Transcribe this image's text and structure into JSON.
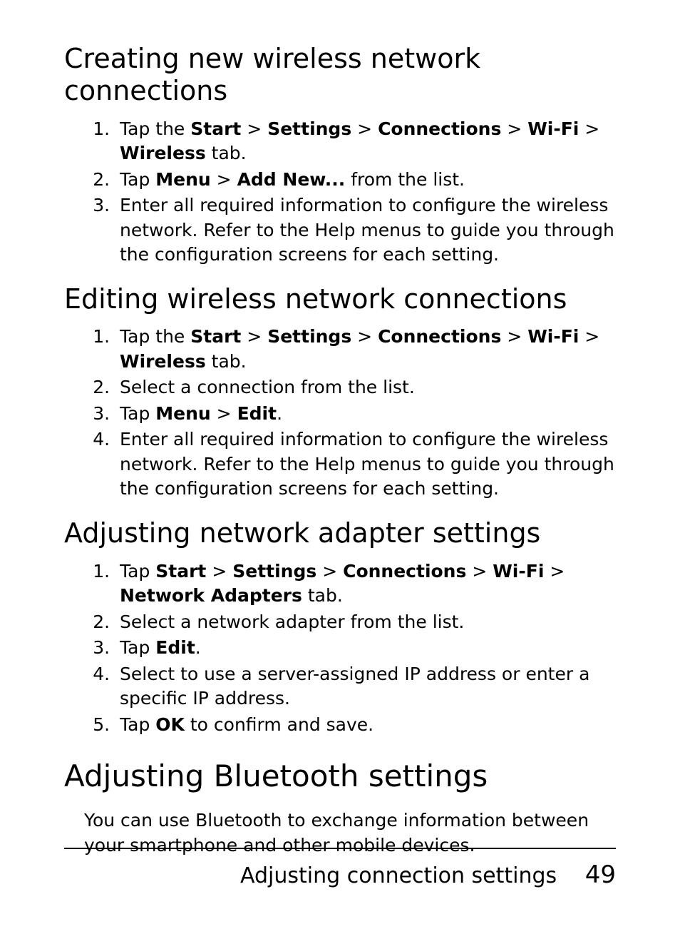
{
  "sections": [
    {
      "heading": "Creating new wireless network connections",
      "level": "h2",
      "items": [
        {
          "segments": [
            {
              "t": "Tap the "
            },
            {
              "t": "Start",
              "b": true
            },
            {
              "t": " > "
            },
            {
              "t": "Settings",
              "b": true
            },
            {
              "t": " > "
            },
            {
              "t": "Connections",
              "b": true
            },
            {
              "t": " > "
            },
            {
              "t": "Wi-Fi",
              "b": true
            },
            {
              "t": " > "
            },
            {
              "t": "Wireless",
              "b": true
            },
            {
              "t": " tab."
            }
          ]
        },
        {
          "segments": [
            {
              "t": "Tap "
            },
            {
              "t": "Menu",
              "b": true
            },
            {
              "t": " > "
            },
            {
              "t": "Add New...",
              "b": true
            },
            {
              "t": " from the list."
            }
          ]
        },
        {
          "segments": [
            {
              "t": "Enter all required information to configure the wireless network. Refer to the Help menus to guide you through the configuration screens for each setting."
            }
          ]
        }
      ]
    },
    {
      "heading": "Editing wireless network connections",
      "level": "h2",
      "items": [
        {
          "segments": [
            {
              "t": "Tap the "
            },
            {
              "t": "Start",
              "b": true
            },
            {
              "t": " > "
            },
            {
              "t": "Settings",
              "b": true
            },
            {
              "t": " > "
            },
            {
              "t": "Connections",
              "b": true
            },
            {
              "t": " > "
            },
            {
              "t": "Wi-Fi",
              "b": true
            },
            {
              "t": " > "
            },
            {
              "t": "Wireless",
              "b": true
            },
            {
              "t": " tab."
            }
          ]
        },
        {
          "segments": [
            {
              "t": "Select a connection from the list."
            }
          ]
        },
        {
          "segments": [
            {
              "t": "Tap "
            },
            {
              "t": "Menu",
              "b": true
            },
            {
              "t": " > "
            },
            {
              "t": "Edit",
              "b": true
            },
            {
              "t": "."
            }
          ]
        },
        {
          "segments": [
            {
              "t": "Enter all required information to configure the wireless network. Refer to the Help menus to guide you through the configuration screens for each setting."
            }
          ]
        }
      ]
    },
    {
      "heading": "Adjusting network adapter settings",
      "level": "h2",
      "items": [
        {
          "segments": [
            {
              "t": "Tap "
            },
            {
              "t": "Start",
              "b": true
            },
            {
              "t": " > "
            },
            {
              "t": "Settings",
              "b": true
            },
            {
              "t": " > "
            },
            {
              "t": "Connections",
              "b": true
            },
            {
              "t": " > "
            },
            {
              "t": "Wi-Fi",
              "b": true
            },
            {
              "t": " > "
            },
            {
              "t": "Network Adapters",
              "b": true
            },
            {
              "t": " tab."
            }
          ]
        },
        {
          "segments": [
            {
              "t": "Select a network adapter from the list."
            }
          ]
        },
        {
          "segments": [
            {
              "t": "Tap "
            },
            {
              "t": "Edit",
              "b": true
            },
            {
              "t": "."
            }
          ]
        },
        {
          "segments": [
            {
              "t": "Select to use a server-assigned IP address or enter a specific IP address."
            }
          ]
        },
        {
          "segments": [
            {
              "t": "Tap "
            },
            {
              "t": "OK",
              "b": true
            },
            {
              "t": " to confirm and save."
            }
          ]
        }
      ]
    },
    {
      "heading": "Adjusting Bluetooth settings",
      "level": "h1",
      "paragraph": "You can use Bluetooth to exchange information between your smartphone and other mobile devices."
    }
  ],
  "footer": {
    "title": "Adjusting connection settings",
    "page": "49"
  }
}
